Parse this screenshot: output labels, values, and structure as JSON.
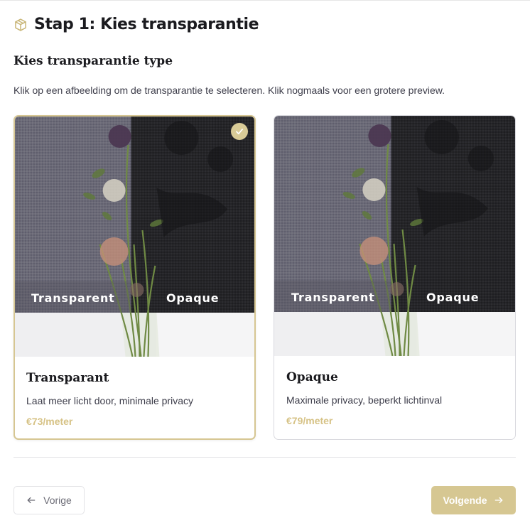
{
  "step": {
    "title": "Stap 1: Kies transparantie",
    "icon": "cube-icon"
  },
  "section": {
    "title": "Kies transparantie type",
    "instructions": "Klik op een afbeelding om de transparantie te selecteren. Klik nogmaals voor een grotere preview."
  },
  "options": [
    {
      "title": "Transparant",
      "description": "Laat meer licht door, minimale privacy",
      "price": "€73/meter",
      "image_labels": [
        "Transparent",
        "Opaque"
      ],
      "selected": true
    },
    {
      "title": "Opaque",
      "description": "Maximale privacy, beperkt lichtinval",
      "price": "€79/meter",
      "image_labels": [
        "Transparent",
        "Opaque"
      ],
      "selected": false
    }
  ],
  "nav": {
    "prev_label": "Vorige",
    "next_label": "Volgende"
  },
  "colors": {
    "accent": "#d6c792",
    "price": "#d6c285"
  }
}
